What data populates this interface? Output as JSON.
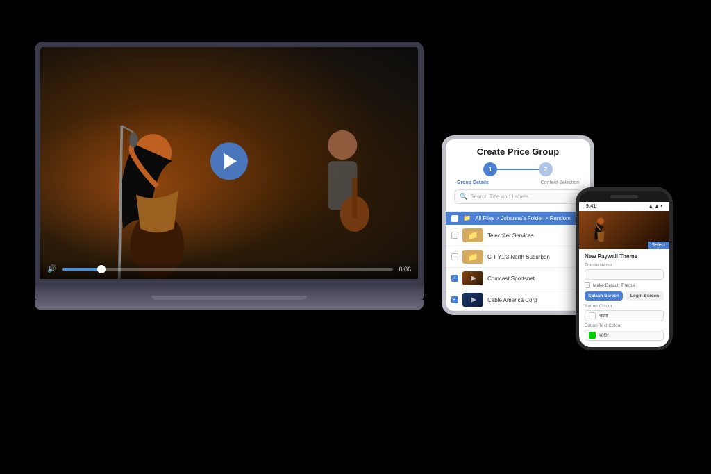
{
  "scene": {
    "background": "#000000"
  },
  "laptop": {
    "video": {
      "time_current": "0:06",
      "time_total": "0:06",
      "progress_percent": 12
    },
    "controls": {
      "play_label": "▶",
      "volume_label": "🔊"
    }
  },
  "tablet": {
    "title": "Create Price Group",
    "stepper": {
      "step1_label": "Group Details",
      "step2_label": "Content Selection",
      "step1_num": "1",
      "step2_num": "2"
    },
    "search": {
      "placeholder": "Search Title and Labels..."
    },
    "breadcrumb": {
      "text": "All Files > Johanna's Folder > Random"
    },
    "files": [
      {
        "name": "Telecoller Services",
        "type": "folder",
        "checked": false
      },
      {
        "name": "C T Y1/3 North Suburban",
        "type": "folder",
        "checked": false
      },
      {
        "name": "Comcast Sportsnet",
        "type": "video",
        "checked": true
      },
      {
        "name": "Cable America Corp",
        "type": "video",
        "checked": true
      }
    ]
  },
  "phone": {
    "status_bar": {
      "time": "9:41",
      "icons": "▲ WiFi Batt"
    },
    "form_title": "New Paywall Theme",
    "fields": [
      {
        "label": "Theme Name",
        "value": "",
        "placeholder": ""
      },
      {
        "label": "Make Default Theme",
        "type": "checkbox"
      }
    ],
    "button_row": {
      "splash_label": "Splash Screen",
      "login_label": "Login Screen"
    },
    "button_color_label": "Button Colour",
    "button_color_value": "#ffffff",
    "button_color_swatch": "#ffffff",
    "button_text_color_label": "Button Text Colour",
    "button_text_color_value": "#0f0f",
    "button_text_color_swatch": "#00ff00",
    "top_action_label": "Select"
  }
}
